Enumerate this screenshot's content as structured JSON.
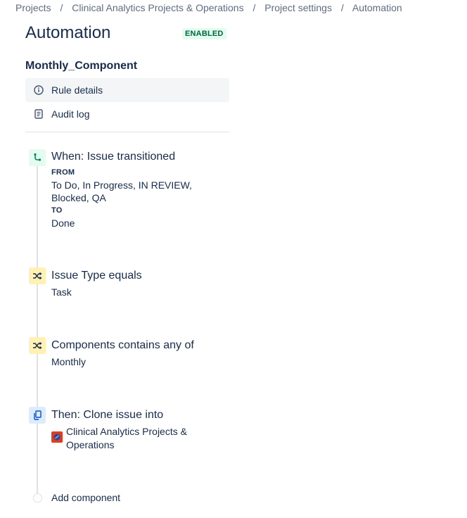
{
  "breadcrumb": [
    "Projects",
    "Clinical Analytics Projects & Operations",
    "Project settings",
    "Automation"
  ],
  "page": {
    "title": "Automation",
    "status": "ENABLED"
  },
  "rule": {
    "name": "Monthly_Component"
  },
  "nav": {
    "rule_details": "Rule details",
    "audit_log": "Audit log"
  },
  "steps": {
    "trigger": {
      "title": "When: Issue transitioned",
      "from_label": "FROM",
      "from_value": "To Do, In Progress, IN REVIEW, Blocked, QA",
      "to_label": "TO",
      "to_value": "Done"
    },
    "condition1": {
      "title": "Issue Type equals",
      "value": "Task"
    },
    "condition2": {
      "title": "Components contains any of",
      "value": "Monthly"
    },
    "action": {
      "title": "Then: Clone issue into",
      "project": "Clinical Analytics Projects & Operations"
    }
  },
  "add_component": "Add component",
  "colors": {
    "badge_bg": "#e3fcef",
    "badge_text": "#006644",
    "trigger_bg": "#e3fcef",
    "condition_bg": "#fff0b3",
    "action_bg": "#deebff",
    "project_icon": "#e03b24"
  },
  "icons": {
    "rule_details": "info-icon",
    "audit_log": "document-icon",
    "trigger": "branch-icon",
    "condition": "shuffle-icon",
    "action": "copy-icon"
  }
}
